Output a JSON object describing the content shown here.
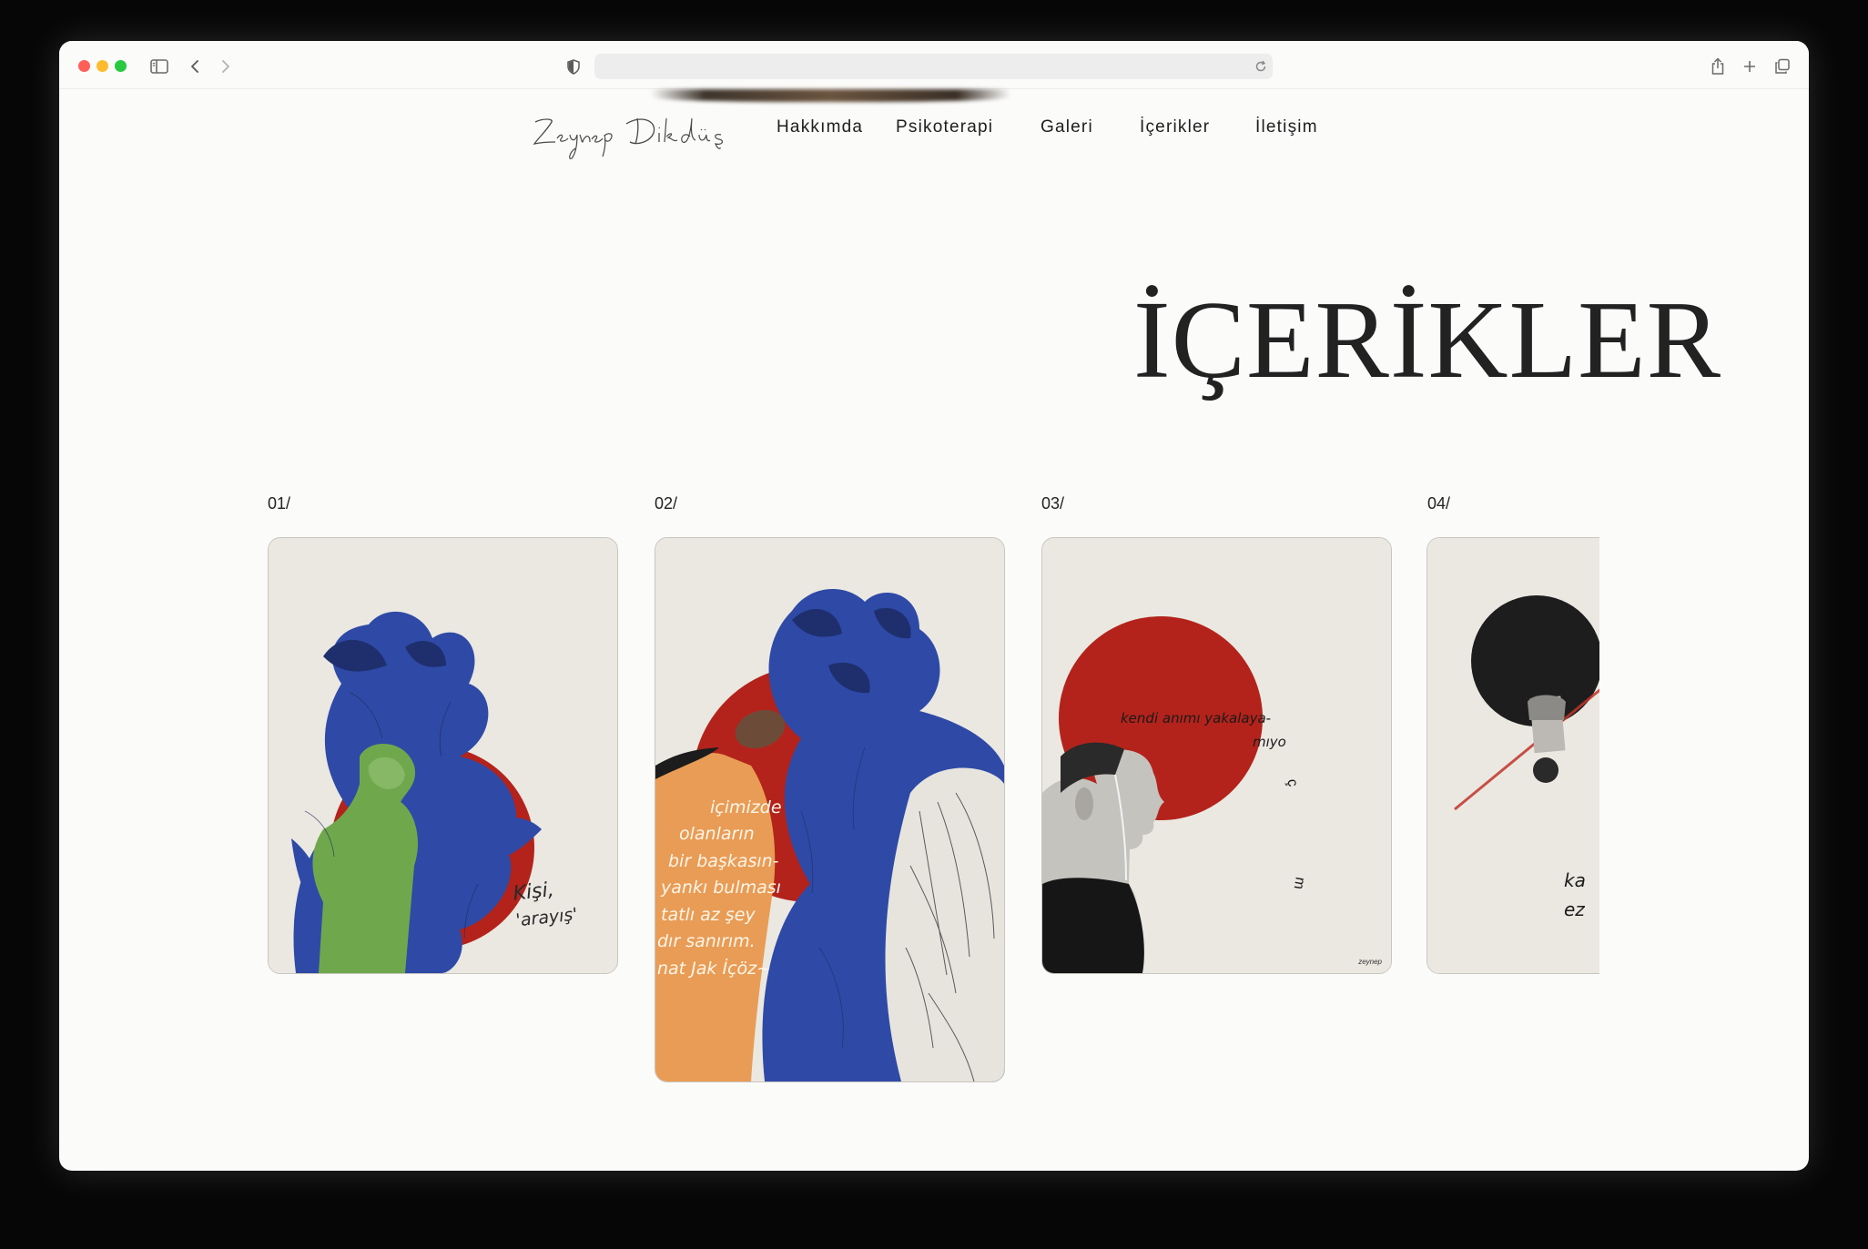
{
  "browser": {
    "url": ""
  },
  "site": {
    "logo_text": "Zeynep Dikdüş",
    "nav": [
      "Hakkımda",
      "Psikoterapi",
      "Galeri",
      "İçerikler",
      "İletişim"
    ]
  },
  "page": {
    "title": "İÇERİKLER"
  },
  "cards": [
    {
      "number": "01/",
      "caption": [
        "Kişi,",
        "'arayış'"
      ]
    },
    {
      "number": "02/",
      "caption": [
        "içimizde",
        "olanların",
        "bir başkasın-",
        "yankı bulması",
        "tatlı az şey",
        "dır sanırım.",
        "nat Jak İçöz~"
      ]
    },
    {
      "number": "03/",
      "caption": [
        "kendi anımı yakalaya-",
        "mıyo"
      ],
      "signature": "zeynep"
    },
    {
      "number": "04/",
      "caption": [
        "ka",
        "ez"
      ]
    }
  ],
  "colors": {
    "red": "#b3231b",
    "blue": "#2e4aa6",
    "paper": "#ebe8e2"
  }
}
